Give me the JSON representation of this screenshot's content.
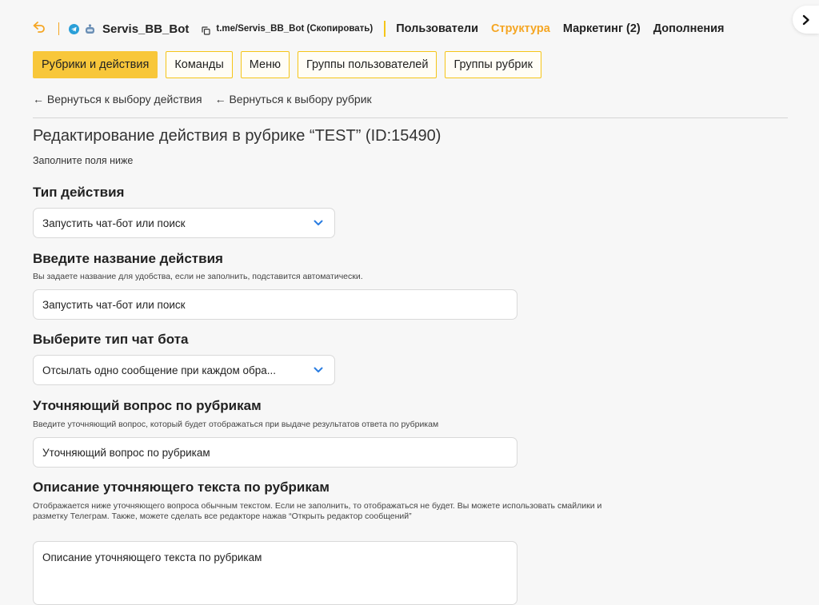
{
  "topbar": {
    "bot_name": "Servis_BB_Bot",
    "bot_link": "t.me/Servis_BB_Bot (Скопировать)",
    "nav": [
      {
        "label": "Пользователи",
        "active": false
      },
      {
        "label": "Структура",
        "active": true
      },
      {
        "label": "Маркетинг (2)",
        "active": false
      },
      {
        "label": "Дополнения",
        "active": false
      }
    ]
  },
  "tabs": [
    {
      "label": "Рубрики и действия",
      "active": true
    },
    {
      "label": "Команды",
      "active": false
    },
    {
      "label": "Меню",
      "active": false
    },
    {
      "label": "Группы пользователей",
      "active": false
    },
    {
      "label": "Группы рубрик",
      "active": false
    }
  ],
  "backlinks": {
    "to_actions": "← Вернуться к выбору действия",
    "to_rubrics": "← Вернуться к выбору рубрик"
  },
  "page": {
    "title": "Редактирование действия в рубрике “TEST” (ID:15490)",
    "subtitle": "Заполните поля ниже"
  },
  "form": {
    "action_type": {
      "label": "Тип действия",
      "value": "Запустить чат-бот или поиск"
    },
    "action_name": {
      "label": "Введите название действия",
      "hint": "Вы задаете название для удобства, если не заполнить, подставится автоматически.",
      "value": "Запустить чат-бот или поиск"
    },
    "chatbot_type": {
      "label": "Выберите тип чат бота",
      "value": "Отсылать одно сообщение при каждом обра..."
    },
    "clarify_question": {
      "label": "Уточняющий вопрос по рубрикам",
      "hint": "Введите уточняющий вопрос, который будет отображаться при выдаче результатов ответа по рубрикам",
      "value": "Уточняющий вопрос по рубрикам"
    },
    "clarify_description": {
      "label": "Описание уточняющего текста по рубрикам",
      "hint": "Отображается ниже уточняющего вопроса обычным текстом. Если не заполнить, то отображаться не будет. Вы можете использовать смайлики и разметку Телеграм. Также, можете сделать все редакторе нажав “Открыть редактор сообщений”",
      "value": "Описание уточняющего текста по рубрикам"
    }
  },
  "colors": {
    "accent": "#f5a623",
    "tab_active": "#f8c73a",
    "tab_border": "#f5c518",
    "select_chevron": "#2a7de1"
  },
  "icons": [
    "back-arrow-icon",
    "telegram-icon",
    "bot-icon",
    "copy-icon",
    "chevron-down-icon",
    "chevron-right-icon"
  ]
}
